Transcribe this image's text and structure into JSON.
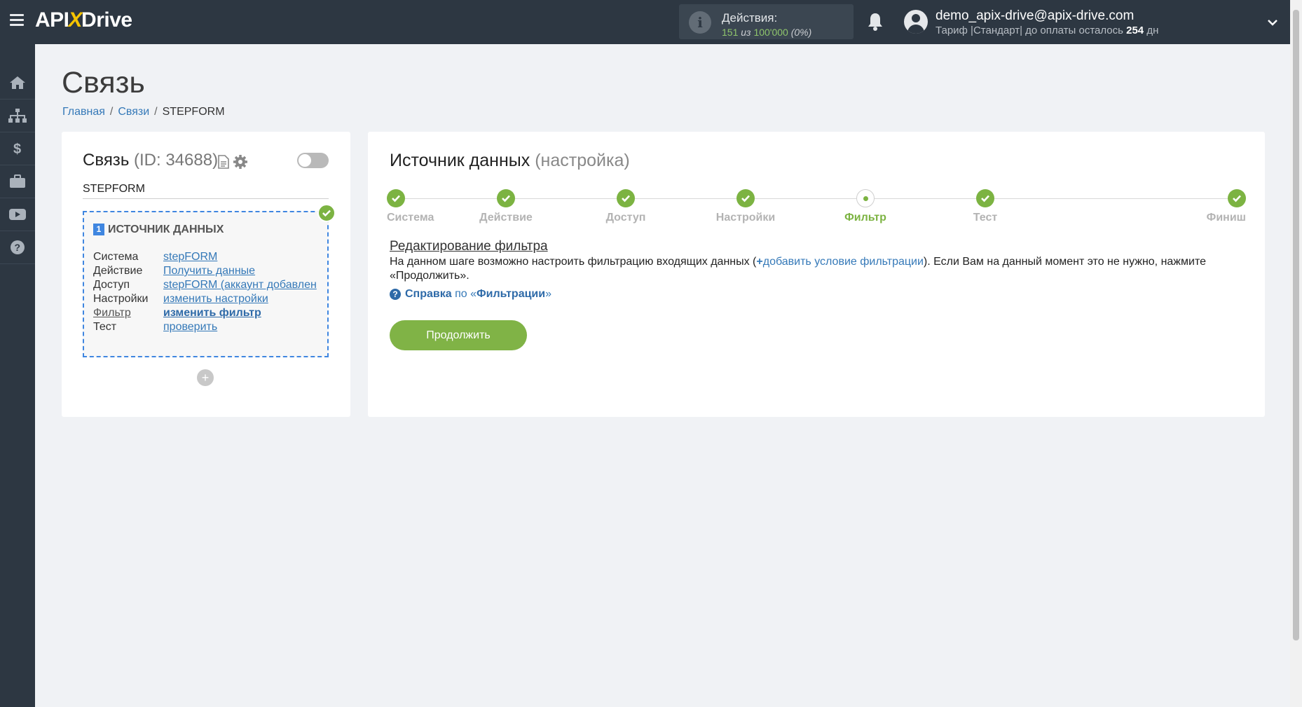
{
  "header": {
    "logo_left": "API",
    "logo_x": "X",
    "logo_right": "Drive",
    "actions_label": "Действия:",
    "actions_used": "151",
    "actions_of": "из",
    "actions_total": "100'000",
    "actions_percent": "(0%)",
    "user_email": "demo_apix-drive@apix-drive.com",
    "user_plan_prefix": "Тариф |Стандарт| до оплаты осталось",
    "user_plan_days": "254",
    "user_plan_suffix": "дн"
  },
  "sidebar": {
    "items": [
      {
        "icon": "home-icon"
      },
      {
        "icon": "sitemap-icon"
      },
      {
        "icon": "dollar-icon"
      },
      {
        "icon": "briefcase-icon"
      },
      {
        "icon": "video-icon"
      },
      {
        "icon": "help-icon"
      }
    ]
  },
  "page": {
    "title": "Связь",
    "breadcrumb": {
      "home": "Главная",
      "links": "Связи",
      "current": "STEPFORM"
    }
  },
  "connection": {
    "title": "Связь",
    "id_text": "(ID: 34688)",
    "name": "STEPFORM",
    "source": {
      "number": "1",
      "heading": "ИСТОЧНИК ДАННЫХ",
      "rows": [
        {
          "key": "Система",
          "value": "stepFORM"
        },
        {
          "key": "Действие",
          "value": "Получить данные"
        },
        {
          "key": "Доступ",
          "value": "stepFORM (аккаунт добавлен"
        },
        {
          "key": "Настройки",
          "value": "изменить настройки"
        },
        {
          "key": "Фильтр",
          "value": "изменить фильтр"
        },
        {
          "key": "Тест",
          "value": "проверить"
        }
      ]
    },
    "add_label": "+"
  },
  "setup": {
    "title": "Источник данных",
    "subtitle": "(настройка)",
    "steps": [
      {
        "label": "Система",
        "state": "done"
      },
      {
        "label": "Действие",
        "state": "done"
      },
      {
        "label": "Доступ",
        "state": "done"
      },
      {
        "label": "Настройки",
        "state": "done"
      },
      {
        "label": "Фильтр",
        "state": "current"
      },
      {
        "label": "Тест",
        "state": "done"
      },
      {
        "label": "Финиш",
        "state": "done"
      }
    ],
    "filter_title": "Редактирование фильтра",
    "desc_before": "На данном шаге возможно настроить фильтрацию входящих данных (",
    "desc_plus": "+",
    "desc_link": "добавить условие фильтрации",
    "desc_after": "). Если Вам на данный момент это не нужно, нажмите «Продолжить».",
    "help_icon": "?",
    "help_label": "Справка",
    "help_mid": "по «",
    "help_topic": "Фильтрации",
    "help_end": "»",
    "continue_label": "Продолжить"
  },
  "colors": {
    "topbar": "#2d3742",
    "accent_green": "#7cb342",
    "link_blue": "#3579b8",
    "source_border": "#3f86e0"
  }
}
